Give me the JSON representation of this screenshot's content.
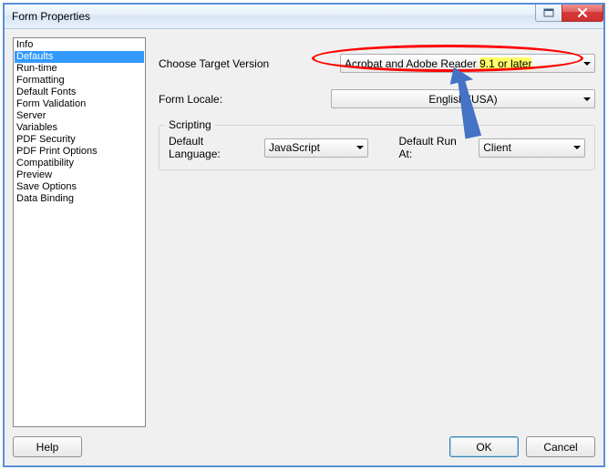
{
  "window": {
    "title": "Form Properties"
  },
  "sidebar": {
    "items": [
      "Info",
      "Defaults",
      "Run-time",
      "Formatting",
      "Default Fonts",
      "Form Validation",
      "Server",
      "Variables",
      "PDF Security",
      "PDF Print Options",
      "Compatibility",
      "Preview",
      "Save Options",
      "Data Binding"
    ],
    "selected_index": 1
  },
  "form": {
    "target_version_label": "Choose Target Version",
    "target_version_value_pre": "Acrobat and Adobe Reader ",
    "target_version_value_hl": "9.1 or later",
    "locale_label": "Form Locale:",
    "locale_value": "English (USA)",
    "scripting_legend": "Scripting",
    "default_lang_label": "Default Language:",
    "default_lang_value": "JavaScript",
    "default_run_label": "Default Run At:",
    "default_run_value": "Client"
  },
  "buttons": {
    "help": "Help",
    "ok": "OK",
    "cancel": "Cancel"
  }
}
